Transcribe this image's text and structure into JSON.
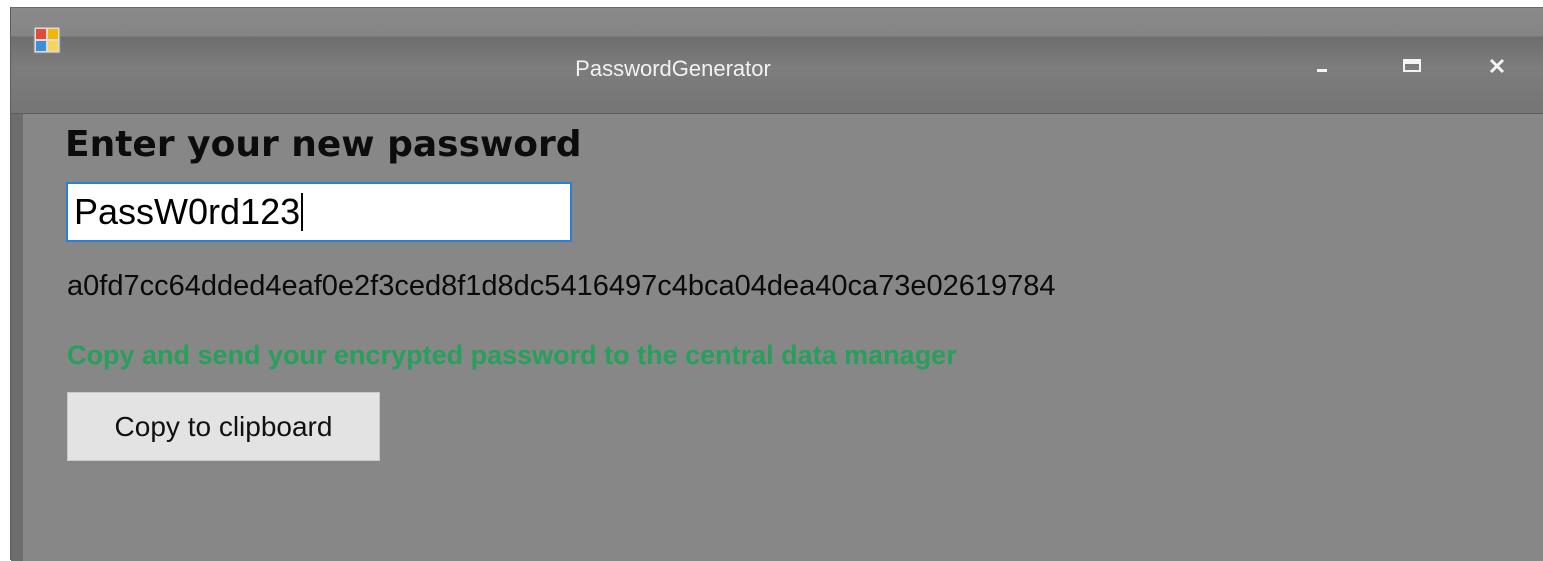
{
  "window": {
    "title": "PasswordGenerator",
    "app_icon": "app-window-icon",
    "controls": {
      "minimize_icon": "minimize-icon",
      "maximize_icon": "maximize-icon",
      "close_icon": "close-icon"
    }
  },
  "form": {
    "heading": "Enter your new password",
    "password_value": "PassW0rd123",
    "hash_output": "a0fd7cc64dded4eaf0e2f3ced8f1d8dc5416497c4bca04dea40ca73e02619784",
    "instruction": "Copy and send your encrypted password to the central data manager",
    "copy_button_label": "Copy to clipboard"
  },
  "colors": {
    "instruction_text": "#26a05a",
    "input_border": "#2a7fd6",
    "window_background": "#878787"
  }
}
